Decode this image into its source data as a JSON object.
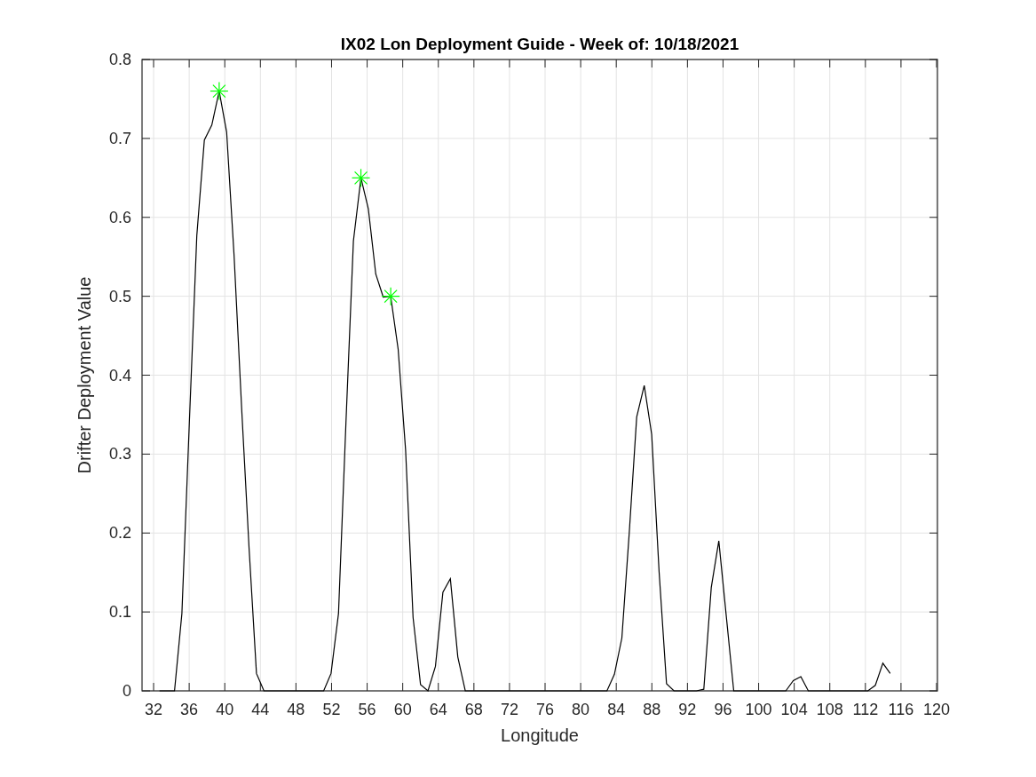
{
  "figure": {
    "chart_data": {
      "type": "line",
      "title": "IX02 Lon Deployment Guide - Week of: 10/18/2021",
      "xlabel": "Longitude",
      "ylabel": "Drifter Deployment Value",
      "x": [
        32.67,
        33.51,
        34.35,
        35.18,
        36.02,
        36.86,
        37.7,
        38.54,
        39.37,
        40.21,
        41.05,
        41.89,
        42.73,
        43.56,
        44.4,
        45.24,
        46.08,
        46.92,
        47.75,
        48.59,
        49.43,
        50.27,
        51.11,
        51.94,
        52.78,
        53.62,
        54.46,
        55.3,
        56.13,
        56.97,
        57.81,
        58.65,
        59.49,
        60.32,
        61.16,
        62.0,
        62.84,
        63.68,
        64.51,
        65.35,
        66.19,
        67.03,
        67.87,
        68.7,
        69.54,
        70.38,
        71.22,
        72.06,
        72.89,
        73.73,
        74.57,
        75.41,
        76.25,
        77.08,
        77.92,
        78.76,
        79.6,
        80.44,
        81.27,
        82.11,
        82.95,
        83.79,
        84.63,
        85.46,
        86.3,
        87.14,
        87.98,
        88.82,
        89.65,
        90.49,
        91.33,
        92.17,
        93.01,
        93.84,
        94.68,
        95.52,
        96.36,
        97.2,
        98.03,
        98.87,
        99.71,
        100.55,
        101.39,
        102.22,
        103.06,
        103.9,
        104.74,
        105.58,
        106.41,
        107.25,
        108.09,
        108.93,
        109.77,
        110.6,
        111.44,
        112.28,
        113.12,
        113.96,
        114.79
      ],
      "series": [
        {
          "color": "#000000",
          "values": [
            0,
            0,
            0,
            0.098,
            0.34,
            0.577,
            0.698,
            0.717,
            0.76,
            0.708,
            0.551,
            0.358,
            0.18,
            0.022,
            0,
            0,
            0,
            0,
            0,
            0,
            0,
            0,
            0,
            0.022,
            0.098,
            0.34,
            0.57,
            0.65,
            0.611,
            0.528,
            0.499,
            0.5,
            0.433,
            0.305,
            0.093,
            0.008,
            0,
            0.031,
            0.125,
            0.142,
            0.043,
            0,
            0,
            0,
            0,
            0,
            0,
            0,
            0,
            0,
            0,
            0,
            0,
            0,
            0,
            0,
            0,
            0,
            0,
            0,
            0,
            0.021,
            0.067,
            0.2,
            0.347,
            0.387,
            0.325,
            0.15,
            0.009,
            0,
            0,
            0,
            0,
            0.002,
            0.131,
            0.19,
            0.095,
            0,
            0,
            0,
            0,
            0,
            0,
            0,
            0,
            0.013,
            0.018,
            0,
            0,
            0,
            0,
            0,
            0,
            0,
            0,
            0,
            0.007,
            0.035,
            0.022
          ]
        },
        {
          "marker": "cross",
          "color": "#00ff00",
          "values": [
            null,
            null,
            null,
            null,
            null,
            null,
            null,
            null,
            0.76,
            null,
            null,
            null,
            null,
            null,
            null,
            null,
            null,
            null,
            null,
            null,
            null,
            null,
            null,
            null,
            null,
            null,
            null,
            0.65,
            null,
            null,
            null,
            0.5,
            null,
            null,
            null,
            null,
            null,
            null,
            null,
            null,
            null,
            null,
            null,
            null,
            null,
            null,
            null,
            null,
            null,
            null,
            null,
            null,
            null,
            null,
            null,
            null,
            null,
            null,
            null,
            null,
            null,
            null,
            null,
            null,
            null,
            null,
            null,
            null,
            null,
            null,
            null,
            null,
            null,
            null,
            null,
            null,
            null,
            null,
            null,
            null,
            null,
            null,
            null,
            null,
            null,
            null,
            null,
            null,
            null,
            null,
            null,
            null,
            null,
            null,
            null,
            null,
            null,
            null,
            null
          ]
        }
      ],
      "grid": true,
      "xlim": [
        30.7,
        120.1
      ],
      "ylim": [
        0,
        0.8
      ],
      "xticks": [
        32,
        36,
        40,
        44,
        48,
        52,
        56,
        60,
        64,
        68,
        72,
        76,
        80,
        84,
        88,
        92,
        96,
        100,
        104,
        108,
        112,
        116,
        120
      ],
      "yticks": [
        0,
        0.1,
        0.2,
        0.3,
        0.4,
        0.5,
        0.6,
        0.7,
        0.8
      ]
    }
  }
}
